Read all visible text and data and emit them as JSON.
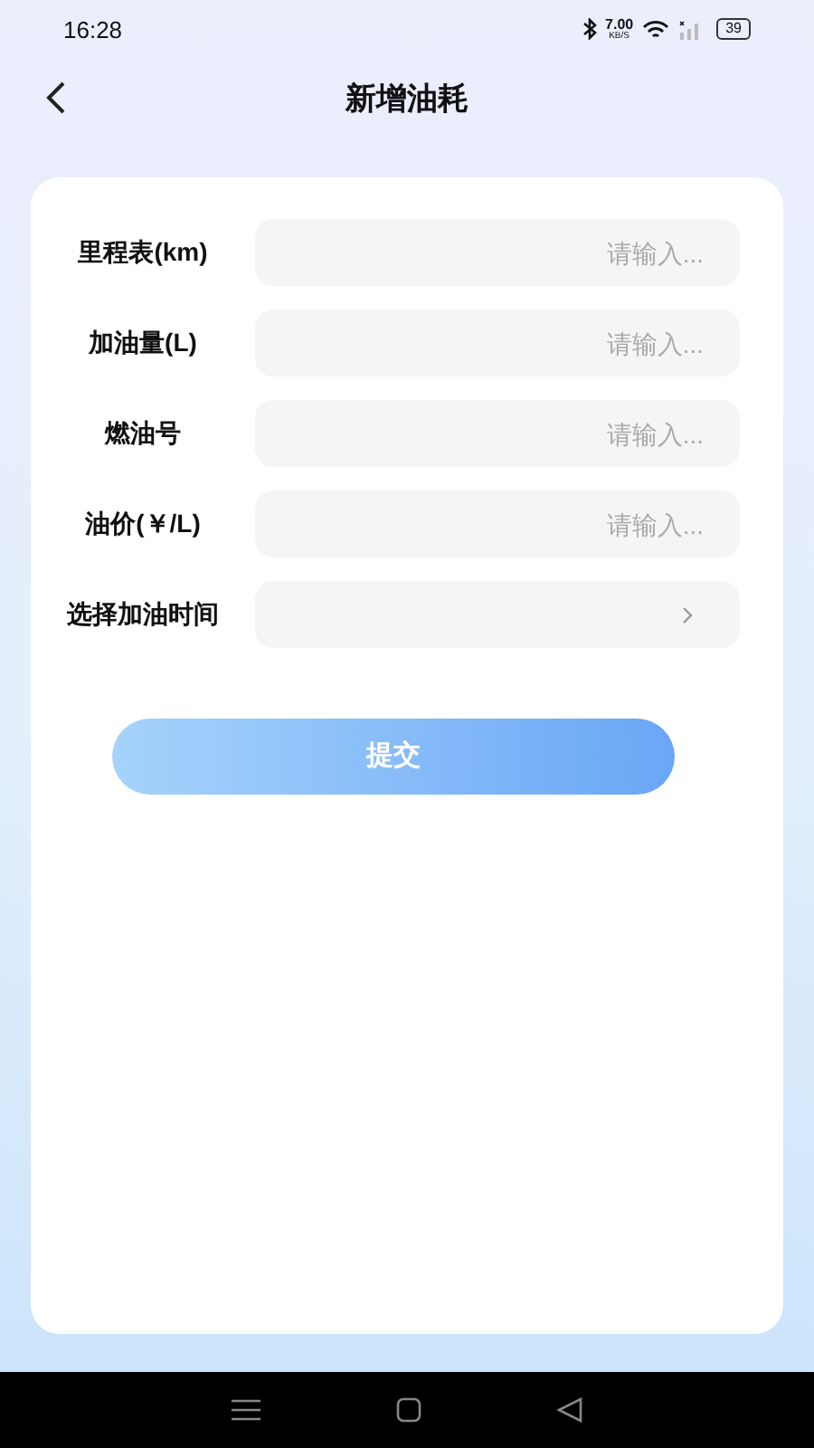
{
  "status_bar": {
    "time": "16:28",
    "speed": "7.00",
    "speed_unit": "KB/S",
    "battery": "39"
  },
  "header": {
    "title": "新增油耗"
  },
  "form": {
    "fields": [
      {
        "kind": "input",
        "label": "里程表(km)",
        "placeholder": "请输入..."
      },
      {
        "kind": "input",
        "label": "加油量(L)",
        "placeholder": "请输入..."
      },
      {
        "kind": "input",
        "label": "燃油号",
        "placeholder": "请输入..."
      },
      {
        "kind": "input",
        "label": "油价(￥/L)",
        "placeholder": "请输入..."
      },
      {
        "kind": "picker",
        "label": "选择加油时间"
      }
    ]
  },
  "submit": {
    "label": "提交"
  }
}
